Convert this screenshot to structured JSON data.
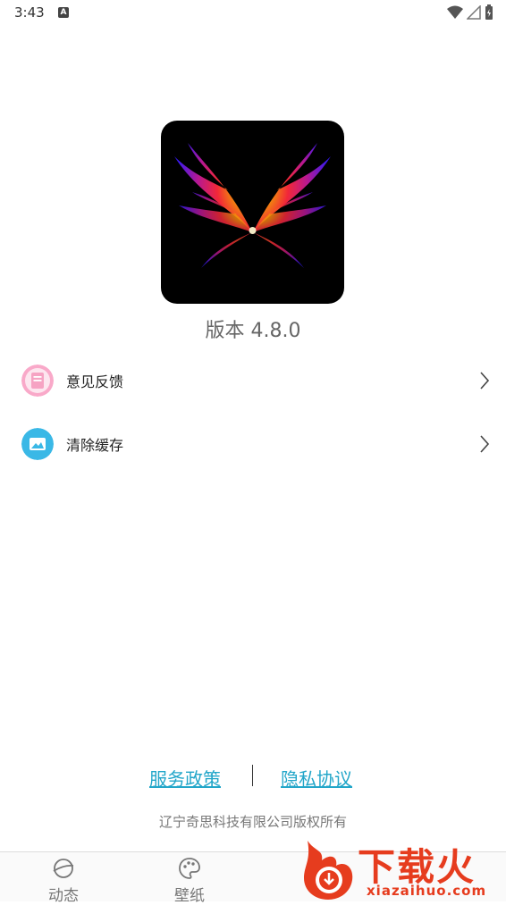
{
  "status_bar": {
    "time": "3:43",
    "notification_badge": "A",
    "icons": [
      "wifi-icon",
      "signal-icon",
      "battery-icon"
    ]
  },
  "app": {
    "logo_icon": "butterfly-wings-logo",
    "version": "版本 4.8.0"
  },
  "menu": {
    "items": [
      {
        "label": "意见反馈",
        "icon": "feedback-icon",
        "icon_color": "#f9a9c9"
      },
      {
        "label": "清除缓存",
        "icon": "image-icon",
        "icon_color": "#3ab8e6"
      }
    ]
  },
  "footer": {
    "service_link": "服务政策",
    "privacy_link": "隐私协议",
    "copyright": "辽宁奇思科技有限公司版权所有",
    "link_color": "#22a6c9"
  },
  "bottom_nav": {
    "items": [
      {
        "label": "动态",
        "icon": "planet-icon"
      },
      {
        "label": "壁纸",
        "icon": "palette-icon"
      }
    ]
  },
  "watermark": {
    "text": "下载火",
    "url": "xiazaihuo.com",
    "color": "#e63c1e"
  }
}
